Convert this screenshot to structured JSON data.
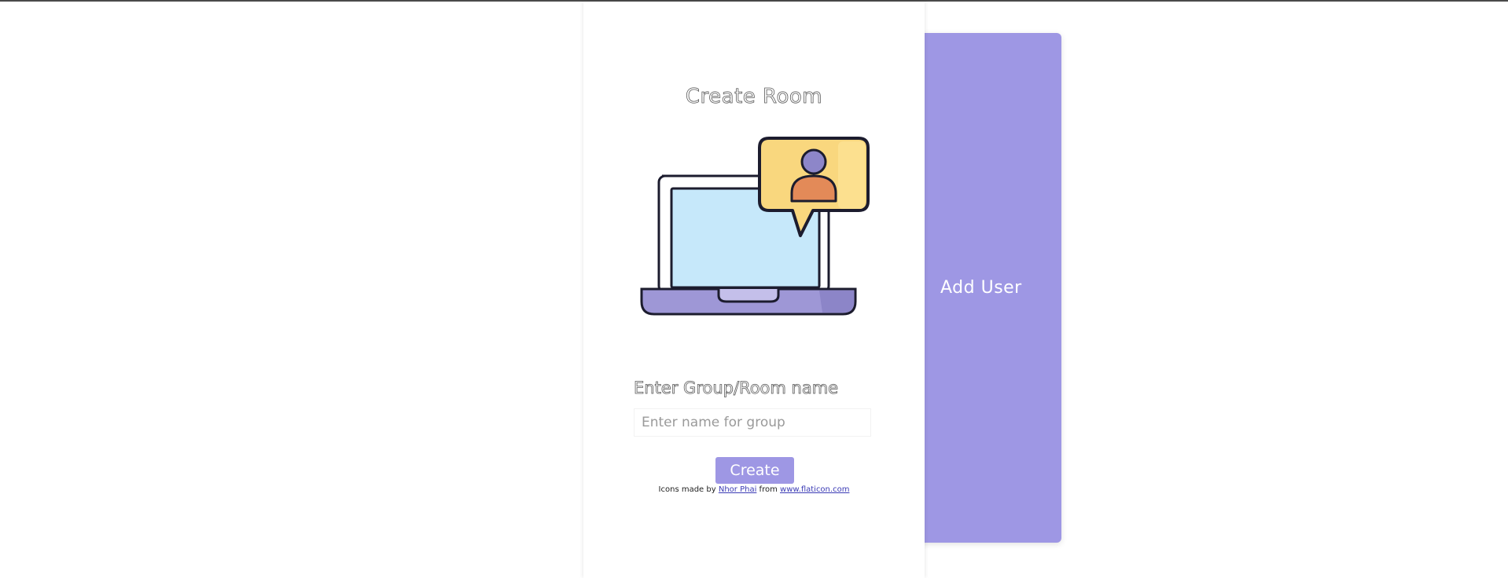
{
  "side_panel": {
    "label": "Add User"
  },
  "form": {
    "title": "Create Room",
    "field_label": "Enter Group/Room name",
    "input_value": "",
    "input_placeholder": "Enter name for group",
    "submit_label": "Create"
  },
  "credits": {
    "prefix": "Icons made by",
    "author": "Nhor Phai",
    "middle": "from",
    "site": "www.flaticon.com"
  },
  "illustration": {
    "icon": "laptop-video-call-icon",
    "colors": {
      "screen": "#c6e8fa",
      "bubble": "#f9d77e",
      "bubble_shade": "#fce08f",
      "person_head": "#8d86c9",
      "person_body": "#e38a58",
      "base": "#9e97d6"
    }
  },
  "colors": {
    "accent": "#9e97e4"
  }
}
